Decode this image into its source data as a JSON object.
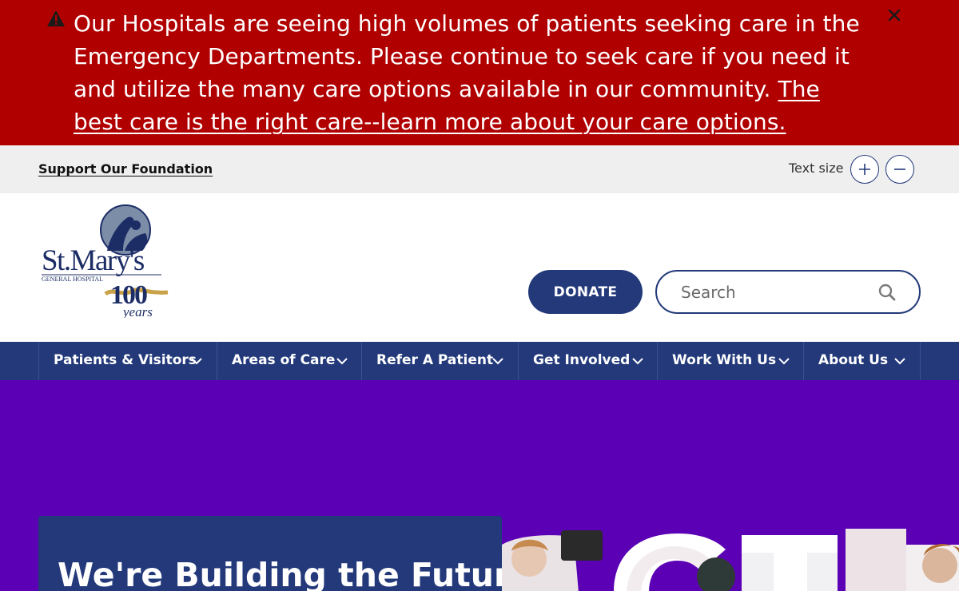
{
  "alert": {
    "message": "Our Hospitals are seeing high volumes of patients seeking care in the Emergency Departments. Please continue to seek care if you need it and utilize the many care options available in our community.",
    "link_text": "The best care is the right care--learn more about your care options.",
    "icon": "warning-triangle-icon",
    "close_icon": "close-icon",
    "color": "#b00000"
  },
  "utility": {
    "support_link": "Support Our Foundation",
    "text_size_label": "Text size",
    "increase_icon": "plus-icon",
    "decrease_icon": "minus-icon"
  },
  "header": {
    "logo": {
      "name_line": "St.Mary's",
      "sub_line": "GENERAL HOSPITAL",
      "anniversary": "100",
      "anniversary_word": "years"
    },
    "donate_label": "DONATE",
    "search_placeholder": "Search",
    "search_icon": "search-icon"
  },
  "nav": {
    "items": [
      {
        "label": "Patients & Visitors"
      },
      {
        "label": "Areas of Care"
      },
      {
        "label": "Refer A Patient"
      },
      {
        "label": "Get Involved"
      },
      {
        "label": "Work With Us"
      },
      {
        "label": "About Us"
      }
    ],
    "color": "#23397a"
  },
  "hero": {
    "title": "We're Building the Future",
    "background_color": "#5b00b4"
  }
}
